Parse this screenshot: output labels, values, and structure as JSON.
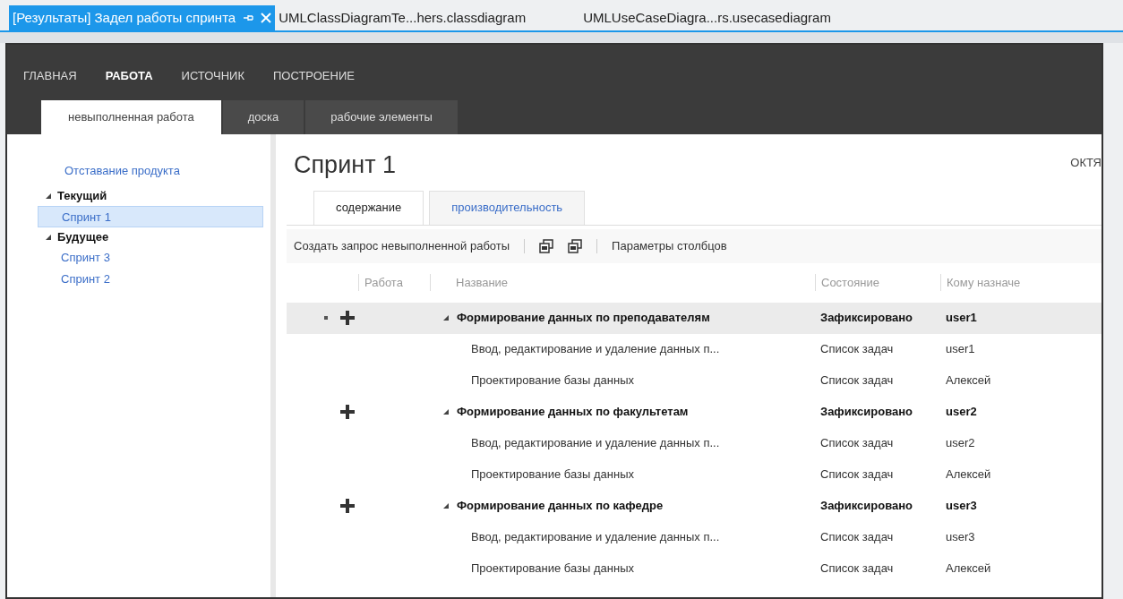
{
  "doc_tabs": [
    {
      "label": "[Результаты] Задел работы спринта",
      "selected": true,
      "pinned": true
    },
    {
      "label": "UMLClassDiagramTe...hers.classdiagram",
      "selected": false,
      "pinned": false
    },
    {
      "label": "UMLUseCaseDiagra...rs.usecasediagram",
      "selected": false,
      "pinned": false
    }
  ],
  "nav": [
    {
      "label": "ГЛАВНАЯ",
      "selected": false
    },
    {
      "label": "РАБОТА",
      "selected": true
    },
    {
      "label": "ИСТОЧНИК",
      "selected": false
    },
    {
      "label": "ПОСТРОЕНИЕ",
      "selected": false
    }
  ],
  "sub_tabs": [
    {
      "label": "невыполненная работа",
      "selected": true
    },
    {
      "label": "доска",
      "selected": false
    },
    {
      "label": "рабочие элементы",
      "selected": false
    }
  ],
  "sidebar": {
    "link": "Отставание продукта",
    "groups": [
      {
        "label": "Текущий",
        "expanded": true,
        "children": [
          {
            "label": "Спринт 1",
            "selected": true
          }
        ]
      },
      {
        "label": "Будущее",
        "expanded": true,
        "children": [
          {
            "label": "Спринт 3",
            "selected": false
          },
          {
            "label": "Спринт 2",
            "selected": false
          }
        ]
      }
    ]
  },
  "title": "Спринт 1",
  "date_fragment": "ОКТЯ",
  "content_tabs": [
    {
      "label": "содержание",
      "selected": true
    },
    {
      "label": "производительность",
      "selected": false
    }
  ],
  "toolbar": {
    "create_query": "Создать запрос невыполненной работы",
    "column_options": "Параметры столбцов"
  },
  "table": {
    "columns": [
      "Работа",
      "Название",
      "Состояние",
      "Кому назначе"
    ],
    "rows": [
      {
        "title": "Формирование данных по преподавателям",
        "state": "Зафиксировано",
        "assigned": "user1",
        "selected": true,
        "expanded": true,
        "children": [
          {
            "title": "Ввод, редактирование и удаление данных п...",
            "state": "Список задач",
            "assigned": "user1"
          },
          {
            "title": "Проектирование базы данных",
            "state": "Список задач",
            "assigned": "Алексей"
          }
        ]
      },
      {
        "title": "Формирование данных по факультетам",
        "state": "Зафиксировано",
        "assigned": "user2",
        "selected": false,
        "expanded": true,
        "children": [
          {
            "title": "Ввод, редактирование и удаление данных п...",
            "state": "Список задач",
            "assigned": "user2"
          },
          {
            "title": "Проектирование базы данных",
            "state": "Список задач",
            "assigned": "Алексей"
          }
        ]
      },
      {
        "title": "Формирование данных по кафедре",
        "state": "Зафиксировано",
        "assigned": "user3",
        "selected": false,
        "expanded": true,
        "children": [
          {
            "title": "Ввод, редактирование и удаление данных п...",
            "state": "Список задач",
            "assigned": "user3"
          },
          {
            "title": "Проектирование базы данных",
            "state": "Список задач",
            "assigned": "Алексей"
          }
        ]
      }
    ]
  }
}
